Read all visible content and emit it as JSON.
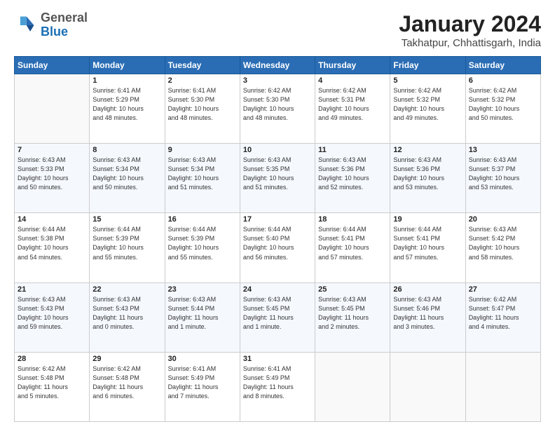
{
  "header": {
    "logo": {
      "general": "General",
      "blue": "Blue"
    },
    "title": "January 2024",
    "subtitle": "Takhatpur, Chhattisgarh, India"
  },
  "calendar": {
    "headers": [
      "Sunday",
      "Monday",
      "Tuesday",
      "Wednesday",
      "Thursday",
      "Friday",
      "Saturday"
    ],
    "rows": [
      [
        {
          "day": "",
          "info": ""
        },
        {
          "day": "1",
          "info": "Sunrise: 6:41 AM\nSunset: 5:29 PM\nDaylight: 10 hours\nand 48 minutes."
        },
        {
          "day": "2",
          "info": "Sunrise: 6:41 AM\nSunset: 5:30 PM\nDaylight: 10 hours\nand 48 minutes."
        },
        {
          "day": "3",
          "info": "Sunrise: 6:42 AM\nSunset: 5:30 PM\nDaylight: 10 hours\nand 48 minutes."
        },
        {
          "day": "4",
          "info": "Sunrise: 6:42 AM\nSunset: 5:31 PM\nDaylight: 10 hours\nand 49 minutes."
        },
        {
          "day": "5",
          "info": "Sunrise: 6:42 AM\nSunset: 5:32 PM\nDaylight: 10 hours\nand 49 minutes."
        },
        {
          "day": "6",
          "info": "Sunrise: 6:42 AM\nSunset: 5:32 PM\nDaylight: 10 hours\nand 50 minutes."
        }
      ],
      [
        {
          "day": "7",
          "info": "Sunrise: 6:43 AM\nSunset: 5:33 PM\nDaylight: 10 hours\nand 50 minutes."
        },
        {
          "day": "8",
          "info": "Sunrise: 6:43 AM\nSunset: 5:34 PM\nDaylight: 10 hours\nand 50 minutes."
        },
        {
          "day": "9",
          "info": "Sunrise: 6:43 AM\nSunset: 5:34 PM\nDaylight: 10 hours\nand 51 minutes."
        },
        {
          "day": "10",
          "info": "Sunrise: 6:43 AM\nSunset: 5:35 PM\nDaylight: 10 hours\nand 51 minutes."
        },
        {
          "day": "11",
          "info": "Sunrise: 6:43 AM\nSunset: 5:36 PM\nDaylight: 10 hours\nand 52 minutes."
        },
        {
          "day": "12",
          "info": "Sunrise: 6:43 AM\nSunset: 5:36 PM\nDaylight: 10 hours\nand 53 minutes."
        },
        {
          "day": "13",
          "info": "Sunrise: 6:43 AM\nSunset: 5:37 PM\nDaylight: 10 hours\nand 53 minutes."
        }
      ],
      [
        {
          "day": "14",
          "info": "Sunrise: 6:44 AM\nSunset: 5:38 PM\nDaylight: 10 hours\nand 54 minutes."
        },
        {
          "day": "15",
          "info": "Sunrise: 6:44 AM\nSunset: 5:39 PM\nDaylight: 10 hours\nand 55 minutes."
        },
        {
          "day": "16",
          "info": "Sunrise: 6:44 AM\nSunset: 5:39 PM\nDaylight: 10 hours\nand 55 minutes."
        },
        {
          "day": "17",
          "info": "Sunrise: 6:44 AM\nSunset: 5:40 PM\nDaylight: 10 hours\nand 56 minutes."
        },
        {
          "day": "18",
          "info": "Sunrise: 6:44 AM\nSunset: 5:41 PM\nDaylight: 10 hours\nand 57 minutes."
        },
        {
          "day": "19",
          "info": "Sunrise: 6:44 AM\nSunset: 5:41 PM\nDaylight: 10 hours\nand 57 minutes."
        },
        {
          "day": "20",
          "info": "Sunrise: 6:43 AM\nSunset: 5:42 PM\nDaylight: 10 hours\nand 58 minutes."
        }
      ],
      [
        {
          "day": "21",
          "info": "Sunrise: 6:43 AM\nSunset: 5:43 PM\nDaylight: 10 hours\nand 59 minutes."
        },
        {
          "day": "22",
          "info": "Sunrise: 6:43 AM\nSunset: 5:43 PM\nDaylight: 11 hours\nand 0 minutes."
        },
        {
          "day": "23",
          "info": "Sunrise: 6:43 AM\nSunset: 5:44 PM\nDaylight: 11 hours\nand 1 minute."
        },
        {
          "day": "24",
          "info": "Sunrise: 6:43 AM\nSunset: 5:45 PM\nDaylight: 11 hours\nand 1 minute."
        },
        {
          "day": "25",
          "info": "Sunrise: 6:43 AM\nSunset: 5:45 PM\nDaylight: 11 hours\nand 2 minutes."
        },
        {
          "day": "26",
          "info": "Sunrise: 6:43 AM\nSunset: 5:46 PM\nDaylight: 11 hours\nand 3 minutes."
        },
        {
          "day": "27",
          "info": "Sunrise: 6:42 AM\nSunset: 5:47 PM\nDaylight: 11 hours\nand 4 minutes."
        }
      ],
      [
        {
          "day": "28",
          "info": "Sunrise: 6:42 AM\nSunset: 5:48 PM\nDaylight: 11 hours\nand 5 minutes."
        },
        {
          "day": "29",
          "info": "Sunrise: 6:42 AM\nSunset: 5:48 PM\nDaylight: 11 hours\nand 6 minutes."
        },
        {
          "day": "30",
          "info": "Sunrise: 6:41 AM\nSunset: 5:49 PM\nDaylight: 11 hours\nand 7 minutes."
        },
        {
          "day": "31",
          "info": "Sunrise: 6:41 AM\nSunset: 5:49 PM\nDaylight: 11 hours\nand 8 minutes."
        },
        {
          "day": "",
          "info": ""
        },
        {
          "day": "",
          "info": ""
        },
        {
          "day": "",
          "info": ""
        }
      ]
    ]
  }
}
